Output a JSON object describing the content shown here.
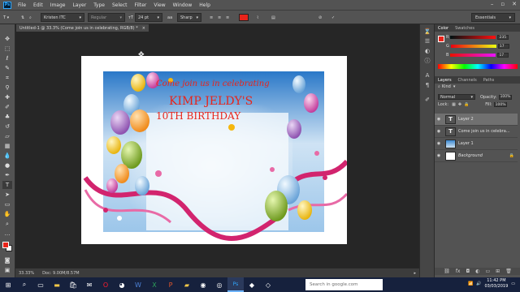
{
  "menu": {
    "logo": "Ps",
    "items": [
      "File",
      "Edit",
      "Image",
      "Layer",
      "Type",
      "Select",
      "Filter",
      "View",
      "Window",
      "Help"
    ]
  },
  "options": {
    "font_family": "Kristen ITC",
    "font_style": "Regular",
    "font_size": "24 pt",
    "antialias_label": "aa",
    "antialias": "Sharp",
    "text_color": "#e8241a",
    "workspace": "Essentials"
  },
  "document": {
    "tab_title": "Untitled-1 @ 33.3% (Come join us in celebrating, RGB/8) *",
    "zoom": "33.33%",
    "doc_size": "Doc: 9.00M/8.57M",
    "text_line1": "Come join us in celebrating",
    "text_line2": "KIMP JELDY'S",
    "text_line3": "10TH BIRTHDAY"
  },
  "color_panel": {
    "tabs": [
      "Color",
      "Swatches"
    ],
    "channels": [
      {
        "label": "R",
        "value": "235"
      },
      {
        "label": "G",
        "value": "17"
      },
      {
        "label": "B",
        "value": "17"
      }
    ]
  },
  "layers_panel": {
    "tabs": [
      "Layers",
      "Channels",
      "Paths"
    ],
    "kind": "Kind",
    "blend_mode": "Normal",
    "opacity_label": "Opacity:",
    "opacity": "100%",
    "lock_label": "Lock:",
    "fill_label": "Fill:",
    "fill": "100%",
    "layers": [
      {
        "name": "Layer 2",
        "kind": "text",
        "selected": true
      },
      {
        "name": "Come join us in celebra...",
        "kind": "text",
        "selected": false
      },
      {
        "name": "Layer 1",
        "kind": "image",
        "selected": false
      },
      {
        "name": "Background",
        "kind": "background",
        "selected": false
      }
    ]
  },
  "taskbar": {
    "search_placeholder": "Search in google.com",
    "time": "11:42 PM",
    "date": "03/03/2019"
  },
  "colors": {
    "accent_red": "#e8241a",
    "taskbar": "#16213d",
    "panel": "#535353"
  }
}
